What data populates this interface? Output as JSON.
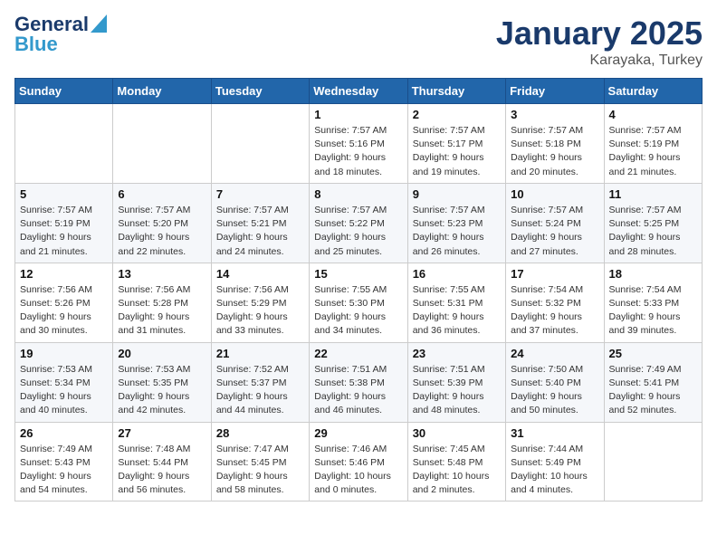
{
  "logo": {
    "line1": "General",
    "line2": "Blue"
  },
  "title": "January 2025",
  "subtitle": "Karayaka, Turkey",
  "days_of_week": [
    "Sunday",
    "Monday",
    "Tuesday",
    "Wednesday",
    "Thursday",
    "Friday",
    "Saturday"
  ],
  "weeks": [
    [
      {
        "day": "",
        "info": ""
      },
      {
        "day": "",
        "info": ""
      },
      {
        "day": "",
        "info": ""
      },
      {
        "day": "1",
        "info": "Sunrise: 7:57 AM\nSunset: 5:16 PM\nDaylight: 9 hours and 18 minutes."
      },
      {
        "day": "2",
        "info": "Sunrise: 7:57 AM\nSunset: 5:17 PM\nDaylight: 9 hours and 19 minutes."
      },
      {
        "day": "3",
        "info": "Sunrise: 7:57 AM\nSunset: 5:18 PM\nDaylight: 9 hours and 20 minutes."
      },
      {
        "day": "4",
        "info": "Sunrise: 7:57 AM\nSunset: 5:19 PM\nDaylight: 9 hours and 21 minutes."
      }
    ],
    [
      {
        "day": "5",
        "info": "Sunrise: 7:57 AM\nSunset: 5:19 PM\nDaylight: 9 hours and 21 minutes."
      },
      {
        "day": "6",
        "info": "Sunrise: 7:57 AM\nSunset: 5:20 PM\nDaylight: 9 hours and 22 minutes."
      },
      {
        "day": "7",
        "info": "Sunrise: 7:57 AM\nSunset: 5:21 PM\nDaylight: 9 hours and 24 minutes."
      },
      {
        "day": "8",
        "info": "Sunrise: 7:57 AM\nSunset: 5:22 PM\nDaylight: 9 hours and 25 minutes."
      },
      {
        "day": "9",
        "info": "Sunrise: 7:57 AM\nSunset: 5:23 PM\nDaylight: 9 hours and 26 minutes."
      },
      {
        "day": "10",
        "info": "Sunrise: 7:57 AM\nSunset: 5:24 PM\nDaylight: 9 hours and 27 minutes."
      },
      {
        "day": "11",
        "info": "Sunrise: 7:57 AM\nSunset: 5:25 PM\nDaylight: 9 hours and 28 minutes."
      }
    ],
    [
      {
        "day": "12",
        "info": "Sunrise: 7:56 AM\nSunset: 5:26 PM\nDaylight: 9 hours and 30 minutes."
      },
      {
        "day": "13",
        "info": "Sunrise: 7:56 AM\nSunset: 5:28 PM\nDaylight: 9 hours and 31 minutes."
      },
      {
        "day": "14",
        "info": "Sunrise: 7:56 AM\nSunset: 5:29 PM\nDaylight: 9 hours and 33 minutes."
      },
      {
        "day": "15",
        "info": "Sunrise: 7:55 AM\nSunset: 5:30 PM\nDaylight: 9 hours and 34 minutes."
      },
      {
        "day": "16",
        "info": "Sunrise: 7:55 AM\nSunset: 5:31 PM\nDaylight: 9 hours and 36 minutes."
      },
      {
        "day": "17",
        "info": "Sunrise: 7:54 AM\nSunset: 5:32 PM\nDaylight: 9 hours and 37 minutes."
      },
      {
        "day": "18",
        "info": "Sunrise: 7:54 AM\nSunset: 5:33 PM\nDaylight: 9 hours and 39 minutes."
      }
    ],
    [
      {
        "day": "19",
        "info": "Sunrise: 7:53 AM\nSunset: 5:34 PM\nDaylight: 9 hours and 40 minutes."
      },
      {
        "day": "20",
        "info": "Sunrise: 7:53 AM\nSunset: 5:35 PM\nDaylight: 9 hours and 42 minutes."
      },
      {
        "day": "21",
        "info": "Sunrise: 7:52 AM\nSunset: 5:37 PM\nDaylight: 9 hours and 44 minutes."
      },
      {
        "day": "22",
        "info": "Sunrise: 7:51 AM\nSunset: 5:38 PM\nDaylight: 9 hours and 46 minutes."
      },
      {
        "day": "23",
        "info": "Sunrise: 7:51 AM\nSunset: 5:39 PM\nDaylight: 9 hours and 48 minutes."
      },
      {
        "day": "24",
        "info": "Sunrise: 7:50 AM\nSunset: 5:40 PM\nDaylight: 9 hours and 50 minutes."
      },
      {
        "day": "25",
        "info": "Sunrise: 7:49 AM\nSunset: 5:41 PM\nDaylight: 9 hours and 52 minutes."
      }
    ],
    [
      {
        "day": "26",
        "info": "Sunrise: 7:49 AM\nSunset: 5:43 PM\nDaylight: 9 hours and 54 minutes."
      },
      {
        "day": "27",
        "info": "Sunrise: 7:48 AM\nSunset: 5:44 PM\nDaylight: 9 hours and 56 minutes."
      },
      {
        "day": "28",
        "info": "Sunrise: 7:47 AM\nSunset: 5:45 PM\nDaylight: 9 hours and 58 minutes."
      },
      {
        "day": "29",
        "info": "Sunrise: 7:46 AM\nSunset: 5:46 PM\nDaylight: 10 hours and 0 minutes."
      },
      {
        "day": "30",
        "info": "Sunrise: 7:45 AM\nSunset: 5:48 PM\nDaylight: 10 hours and 2 minutes."
      },
      {
        "day": "31",
        "info": "Sunrise: 7:44 AM\nSunset: 5:49 PM\nDaylight: 10 hours and 4 minutes."
      },
      {
        "day": "",
        "info": ""
      }
    ]
  ]
}
